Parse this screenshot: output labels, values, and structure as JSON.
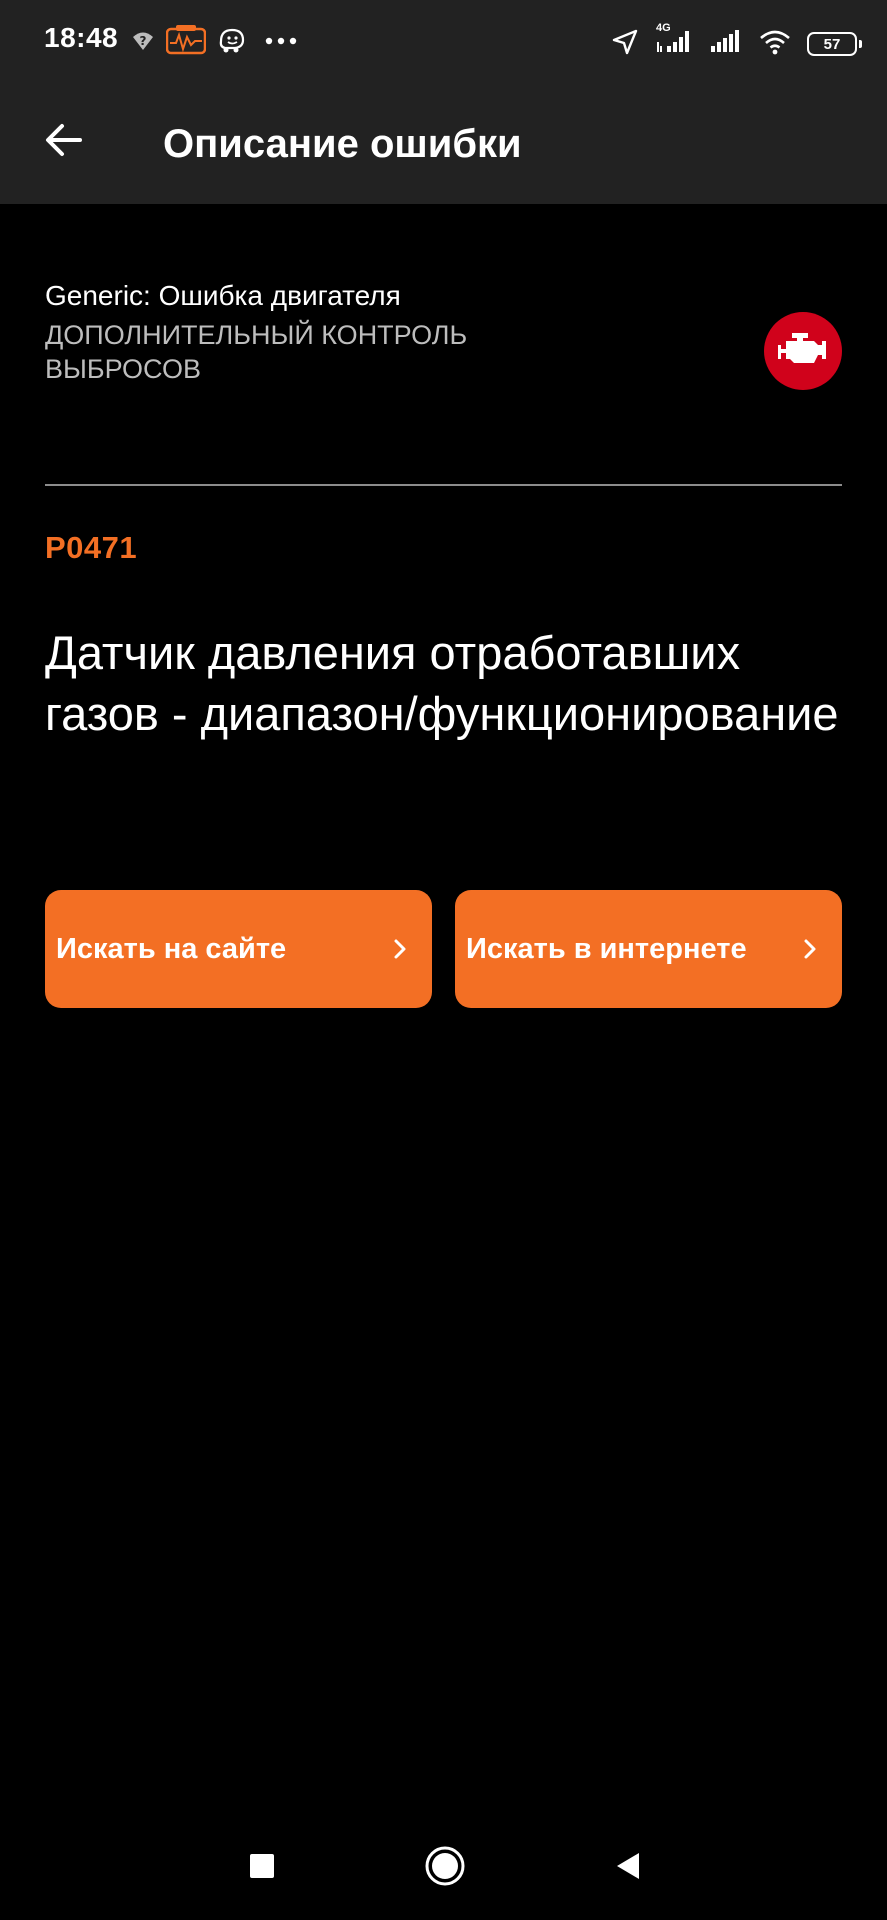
{
  "status_bar": {
    "time": "18:48",
    "network_label": "4G",
    "battery_level": "57",
    "left_icons": [
      "unknown-wifi-icon",
      "car-diagnostic-app-icon",
      "waze-icon",
      "more-dots-icon"
    ],
    "right_icons": [
      "location-arrow-icon",
      "signal-4g-icon",
      "signal-icon",
      "wifi-icon",
      "battery-icon"
    ]
  },
  "app_bar": {
    "title": "Описание ошибки",
    "back_icon": "arrow-left-icon"
  },
  "error": {
    "category": "Generic: Ошибка двигателя",
    "subcategory": "ДОПОЛНИТЕЛЬНЫЙ КОНТРОЛЬ ВЫБРОСОВ",
    "badge_icon": "check-engine-icon",
    "code": "P0471",
    "description": "Датчик давления отработавших газов - диапазон/функционирование"
  },
  "actions": {
    "search_site_label": "Искать на сайте",
    "search_web_label": "Искать в интернете"
  },
  "nav_bar": {
    "icons": [
      "recents-square-icon",
      "home-circle-icon",
      "back-triangle-icon"
    ]
  },
  "colors": {
    "accent": "#f36f24",
    "badge": "#d0021b",
    "bar_background": "#222222",
    "background": "#000000",
    "subtext": "#bdbdbd"
  }
}
